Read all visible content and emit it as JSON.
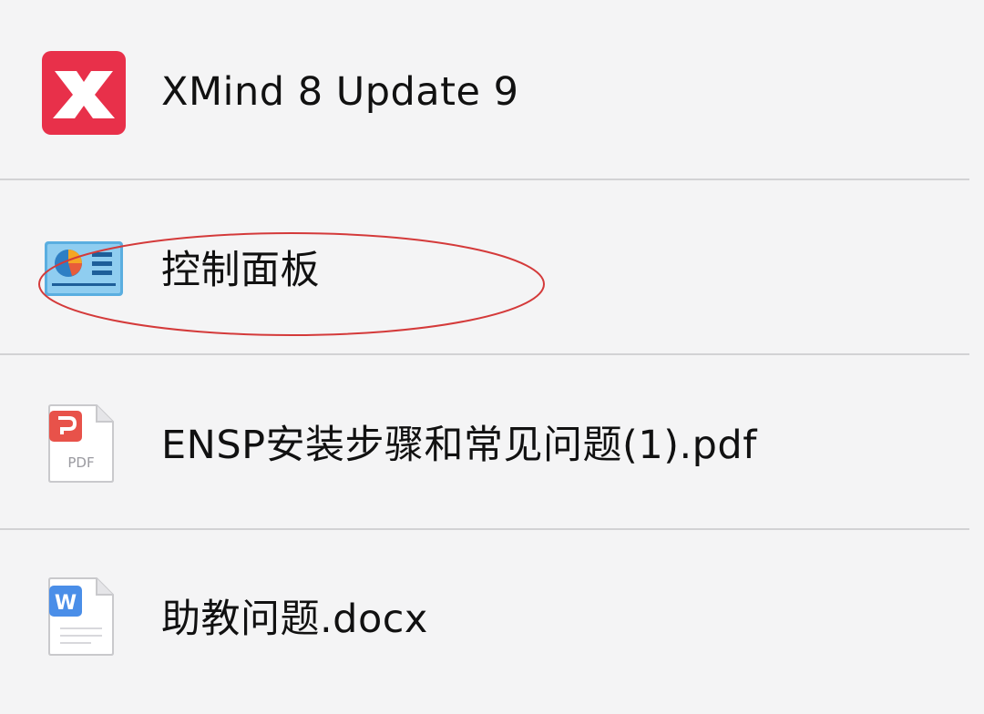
{
  "items": [
    {
      "label": "XMind 8 Update 9",
      "icon": "xmind-app-icon"
    },
    {
      "label": "控制面板",
      "icon": "control-panel-icon"
    },
    {
      "label": "ENSP安装步骤和常见问题(1).pdf",
      "icon": "pdf-file-icon",
      "icon_text": "PDF"
    },
    {
      "label": "助教问题.docx",
      "icon": "word-file-icon",
      "icon_text": "W"
    }
  ],
  "annotation": {
    "shape": "ellipse",
    "color": "#d43a3a",
    "target": "控制面板"
  },
  "colors": {
    "background": "#f4f4f5",
    "divider": "#d2d2d4",
    "xmind_red": "#e8304a",
    "pdf_red": "#e8524a",
    "word_blue": "#4a8ee8"
  }
}
